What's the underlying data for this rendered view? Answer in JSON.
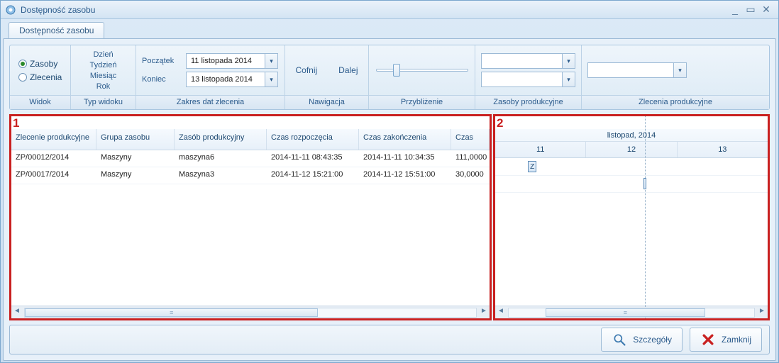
{
  "window": {
    "title": "Dostępność zasobu"
  },
  "tab": {
    "label": "Dostępność zasobu"
  },
  "ribbon": {
    "view": {
      "zasoby": "Zasoby",
      "zlecenia": "Zlecenia",
      "label": "Widok"
    },
    "viewtype": {
      "dzien": "Dzień",
      "tydzien": "Tydzień",
      "miesiac": "Miesiąc",
      "rok": "Rok",
      "label": "Typ widoku"
    },
    "daterange": {
      "start_label": "Początek",
      "end_label": "Koniec",
      "start_value": "11 listopada 2014",
      "end_value": "13 listopada 2014",
      "label": "Zakres dat zlecenia"
    },
    "nav": {
      "back": "Cofnij",
      "fwd": "Dalej",
      "label": "Nawigacja"
    },
    "zoom": {
      "label": "Przybliżenie"
    },
    "resources": {
      "label": "Zasoby produkcyjne"
    },
    "orders": {
      "label": "Zlecenia produkcyjne"
    }
  },
  "annotations": {
    "one": "1",
    "two": "2"
  },
  "table": {
    "headers": {
      "order": "Zlecenie produkcyjne",
      "group": "Grupa zasobu",
      "resource": "Zasób produkcyjny",
      "start": "Czas rozpoczęcia",
      "end": "Czas zakończenia",
      "time": "Czas"
    },
    "rows": [
      {
        "order": "ZP/00012/2014",
        "group": "Maszyny",
        "resource": "maszyna6",
        "start": "2014-11-11 08:43:35",
        "end": "2014-11-11 10:34:35",
        "time": "111,0000"
      },
      {
        "order": "ZP/00017/2014",
        "group": "Maszyny",
        "resource": "Maszyna3",
        "start": "2014-11-12 15:21:00",
        "end": "2014-11-12 15:51:00",
        "time": "30,0000"
      }
    ]
  },
  "gantt": {
    "month": "listopad, 2014",
    "days": [
      "11",
      "12",
      "13"
    ],
    "item1_label": "Z"
  },
  "footer": {
    "details": "Szczegóły",
    "close": "Zamknij"
  }
}
